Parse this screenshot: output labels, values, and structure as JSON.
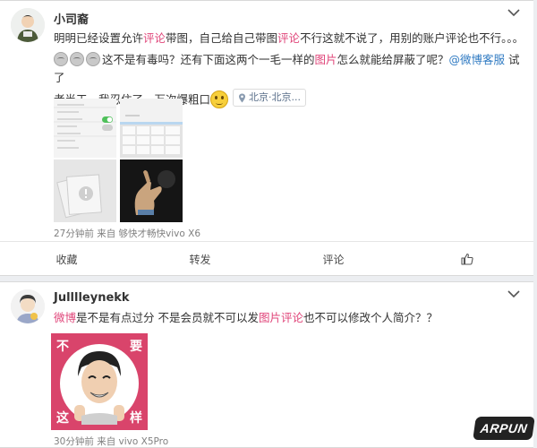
{
  "post1": {
    "author": "小司裔",
    "line1": [
      "明明已经设置允许",
      "评论",
      "带图，自己给自己带图",
      "评论",
      "不行这就不说了，用别的账户评论也不行。。。"
    ],
    "line2": [
      "这不是有毒吗？还有下面这两个一毛一样的",
      "图片",
      "怎么就能给屏蔽了呢？",
      "@微博客服",
      " 试了"
    ],
    "line3": "老半天，我忍住了一万次爆粗口",
    "location": "北京·北京...",
    "meta": "27分钟前 来自 够快才畅快vivo X6",
    "actions": {
      "collect": "收藏",
      "repost": "转发",
      "comment": "评论"
    }
  },
  "post2": {
    "author": "Julllleynekk",
    "text": [
      "微博",
      "是不是有点过分 不是会员就不可以发",
      "图片评论",
      "也不可以修改个人简介？？"
    ],
    "sticker": {
      "tl": "不",
      "tr": "要",
      "bl": "这",
      "br": "样"
    },
    "meta": "30分钟前 来自 vivo X5Pro"
  },
  "watermark": "ARPUN",
  "colors": {
    "highlight": "#e0467a",
    "mention": "#2f7ac2",
    "meta": "#808080",
    "background": "#eceef1"
  }
}
